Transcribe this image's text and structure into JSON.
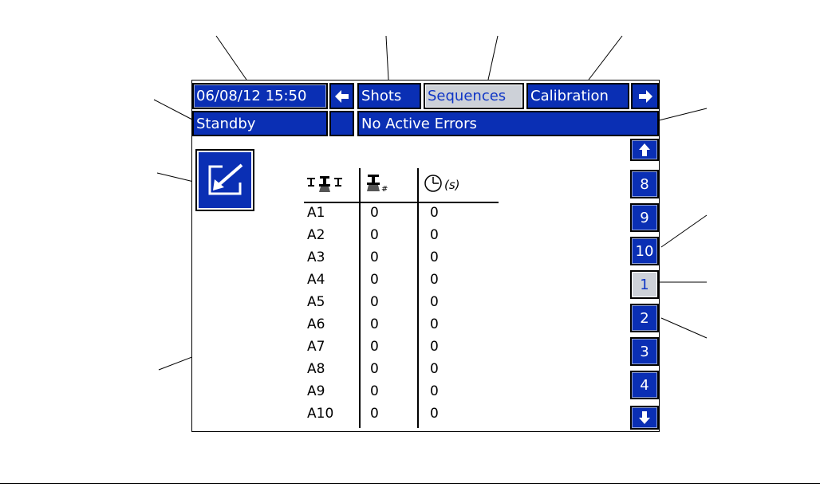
{
  "header": {
    "datetime": "06/08/12 15:50",
    "tabs": [
      {
        "label": "Shots",
        "selected": false
      },
      {
        "label": "Sequences",
        "selected": true
      },
      {
        "label": "Calibration",
        "selected": false
      }
    ],
    "left_arrow_icon": "arrow-left-icon",
    "right_arrow_icon": "arrow-right-icon"
  },
  "status": {
    "mode": "Standby",
    "errors": "No Active Errors"
  },
  "table": {
    "header_icons": [
      "guns-icon",
      "shot-number-icon",
      "timer-icon"
    ],
    "timer_unit": "(s)",
    "rows": [
      {
        "label": "A1",
        "shot": "0",
        "time": "0"
      },
      {
        "label": "A2",
        "shot": "0",
        "time": "0"
      },
      {
        "label": "A3",
        "shot": "0",
        "time": "0"
      },
      {
        "label": "A4",
        "shot": "0",
        "time": "0"
      },
      {
        "label": "A5",
        "shot": "0",
        "time": "0"
      },
      {
        "label": "A6",
        "shot": "0",
        "time": "0"
      },
      {
        "label": "A7",
        "shot": "0",
        "time": "0"
      },
      {
        "label": "A8",
        "shot": "0",
        "time": "0"
      },
      {
        "label": "A9",
        "shot": "0",
        "time": "0"
      },
      {
        "label": "A10",
        "shot": "0",
        "time": "0"
      }
    ]
  },
  "sequence_list": {
    "items": [
      {
        "label": "8",
        "selected": false
      },
      {
        "label": "9",
        "selected": false
      },
      {
        "label": "10",
        "selected": false
      },
      {
        "label": "1",
        "selected": true
      },
      {
        "label": "2",
        "selected": false
      },
      {
        "label": "3",
        "selected": false
      },
      {
        "label": "4",
        "selected": false
      }
    ],
    "up_icon": "arrow-up-icon",
    "down_icon": "arrow-down-icon"
  },
  "colors": {
    "button_blue": "#0a2fb4",
    "selected_gray": "#cdd1d8",
    "selected_text": "#1036c6"
  }
}
